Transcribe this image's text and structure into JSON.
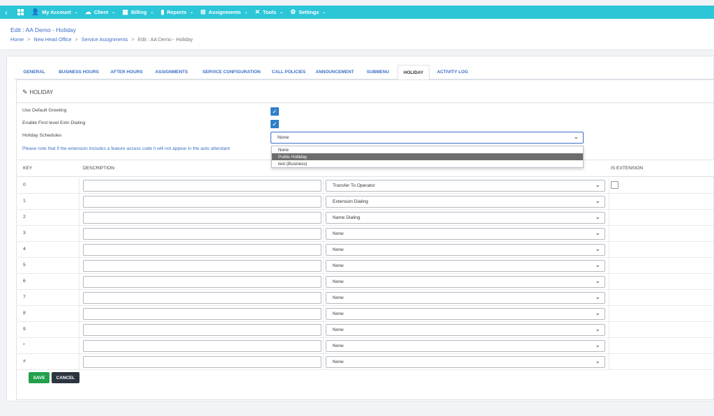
{
  "nav": {
    "back_icon": "chevron-left-icon",
    "apps_icon": "grid-icon",
    "items": [
      {
        "label": "My Account",
        "icon": "user-icon",
        "glyph": "👤"
      },
      {
        "label": "Client",
        "icon": "cloud-icon",
        "glyph": "☁"
      },
      {
        "label": "Billing",
        "icon": "billing-icon",
        "glyph": "▦"
      },
      {
        "label": "Reports",
        "icon": "bar-chart-icon",
        "glyph": "▮"
      },
      {
        "label": "Assignments",
        "icon": "sitemap-icon",
        "glyph": "⊞"
      },
      {
        "label": "Tools",
        "icon": "wrench-icon",
        "glyph": "✕"
      },
      {
        "label": "Settings",
        "icon": "gear-icon",
        "glyph": "⚙"
      }
    ]
  },
  "header": {
    "title": "Edit : AA Demo - Holiday",
    "breadcrumb": [
      "Home",
      "New Head Office",
      "Service Assignments",
      "Edit : AA Demo - Holiday"
    ]
  },
  "tabs": [
    "GENERAL",
    "BUSINESS HOURS",
    "AFTER HOURS",
    "ASSIGNMENTS",
    "SERVICE CONFIGURATION",
    "CALL POLICIES",
    "ANNOUNCEMENT",
    "SUBMENU",
    "HOLIDAY",
    "ACTIVITY LOG"
  ],
  "active_tab": "HOLIDAY",
  "panel": {
    "title": "HOLIDAY",
    "use_default_greeting_label": "Use Default Greeting",
    "use_default_greeting_checked": true,
    "first_level_label": "Enable First level Extn Dialing",
    "first_level_checked": true,
    "holiday_schedules_label": "Holiday Schedules",
    "holiday_schedules_value": "None",
    "holiday_schedules_options": [
      "None",
      "Public Holliday",
      "test (Business)"
    ],
    "highlighted_option": "Public Holliday",
    "notice": "Please note that if the extension includes a feature access code it will not appear in the auto attendant"
  },
  "table": {
    "headers": {
      "key": "KEY",
      "description": "DESCRIPTION",
      "is_extension": "IS EXTENSION"
    },
    "rows": [
      {
        "key": "0",
        "description": "",
        "action": "Transfer To Operator",
        "has_ext_checkbox": true
      },
      {
        "key": "1",
        "description": "",
        "action": "Extension Dialing"
      },
      {
        "key": "2",
        "description": "",
        "action": "Name Dialing"
      },
      {
        "key": "3",
        "description": "",
        "action": "None"
      },
      {
        "key": "4",
        "description": "",
        "action": "None"
      },
      {
        "key": "5",
        "description": "",
        "action": "None"
      },
      {
        "key": "6",
        "description": "",
        "action": "None"
      },
      {
        "key": "7",
        "description": "",
        "action": "None"
      },
      {
        "key": "8",
        "description": "",
        "action": "None"
      },
      {
        "key": "9",
        "description": "",
        "action": "None"
      },
      {
        "key": "*",
        "description": "",
        "action": "None"
      },
      {
        "key": "#",
        "description": "",
        "action": "None"
      }
    ]
  },
  "buttons": {
    "save": "SAVE",
    "cancel": "CANCEL"
  },
  "colors": {
    "topbar": "#2bc6d8",
    "link": "#3b6fc6",
    "save": "#22a04b",
    "cancel": "#2c3540",
    "checkbox": "#2f7fc9"
  }
}
